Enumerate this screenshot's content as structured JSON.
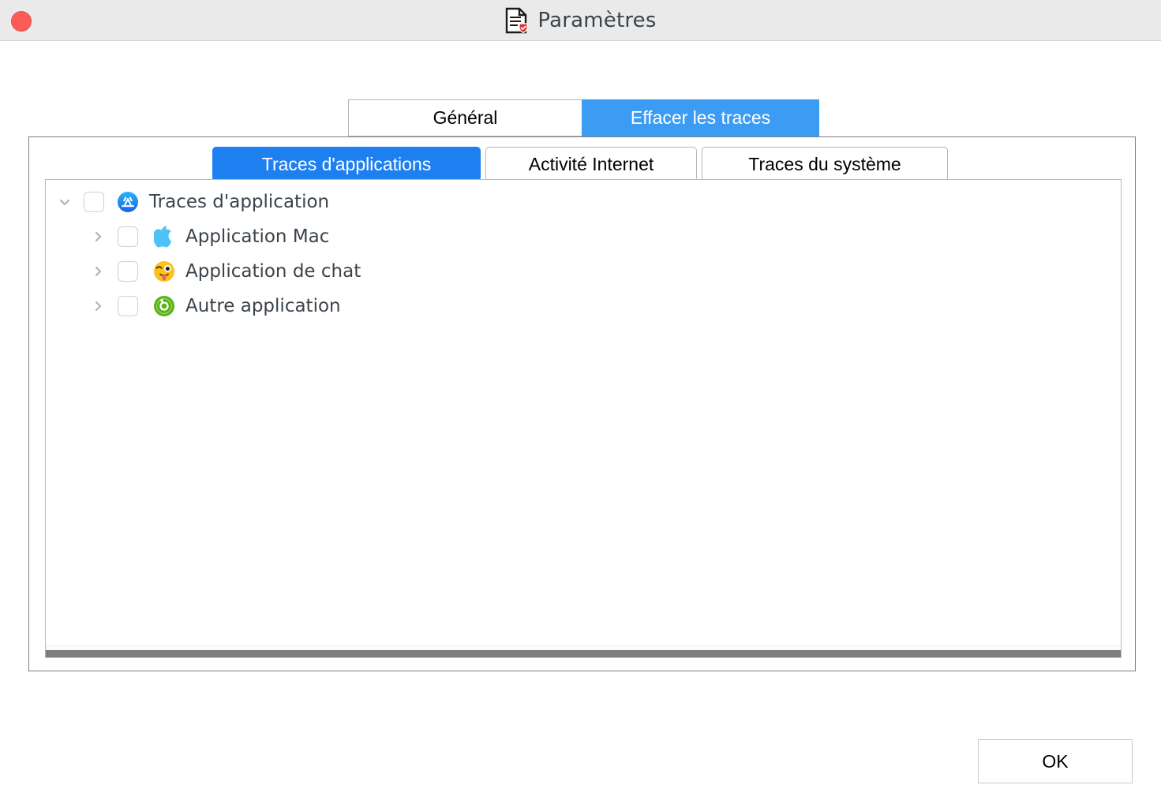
{
  "window": {
    "title": "Paramètres",
    "title_icon": "document-shield-icon",
    "close_button": "close-window-button",
    "titlebar_color": "#eaeaea"
  },
  "top_tabs": {
    "items": [
      {
        "label": "Général",
        "active": false
      },
      {
        "label": "Effacer les traces",
        "active": true
      }
    ],
    "active_color": "#3c9cf4"
  },
  "inner_tabs": {
    "items": [
      {
        "label": "Traces d'applications",
        "active": true
      },
      {
        "label": "Activité Internet",
        "active": false
      },
      {
        "label": "Traces du système",
        "active": false
      }
    ],
    "active_color": "#1e7ff0"
  },
  "tree": {
    "rows": [
      {
        "label": "Traces d'application",
        "depth": 0,
        "expanded": true,
        "checked": false,
        "icon": "app-store-icon",
        "disclosure": "chevron-down-icon"
      },
      {
        "label": "Application Mac",
        "depth": 1,
        "expanded": false,
        "checked": false,
        "icon": "apple-logo-icon",
        "disclosure": "chevron-right-icon"
      },
      {
        "label": "Application de chat",
        "depth": 1,
        "expanded": false,
        "checked": false,
        "icon": "winking-tongue-emoji-icon",
        "disclosure": "chevron-right-icon"
      },
      {
        "label": "Autre application",
        "depth": 1,
        "expanded": false,
        "checked": false,
        "icon": "green-recycle-icon",
        "disclosure": "chevron-right-icon"
      }
    ],
    "scrollbar": {
      "orientation": "horizontal",
      "thumb_color": "#7d7d7d"
    }
  },
  "footer": {
    "ok_label": "OK"
  }
}
